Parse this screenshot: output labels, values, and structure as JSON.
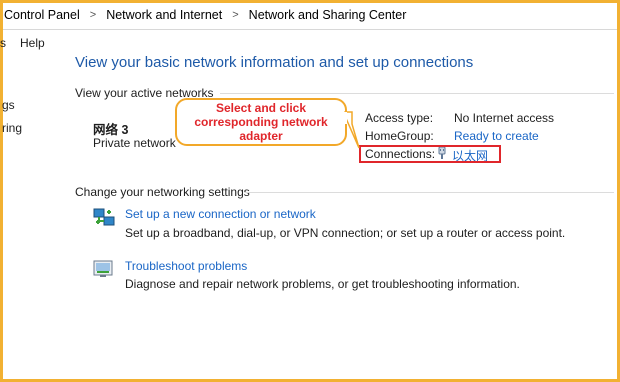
{
  "breadcrumb": {
    "items": [
      "Control Panel",
      "Network and Internet",
      "Network and Sharing Center"
    ],
    "separator": ">"
  },
  "menu": {
    "partial_item": "s",
    "help": "Help"
  },
  "sidebar": {
    "item1_fragment": "gs",
    "item2_fragment": "ring"
  },
  "main": {
    "title": "View your basic network information and set up connections",
    "active_networks_label": "View your active networks",
    "network": {
      "name": "网络 3",
      "type": "Private network",
      "access_type_label": "Access type:",
      "access_type_value": "No Internet access",
      "homegroup_label": "HomeGroup:",
      "homegroup_value": "Ready to create",
      "connections_label": "Connections:",
      "connections_value": "以太网"
    },
    "change_settings_label": "Change your networking settings",
    "tasks": [
      {
        "link": "Set up a new connection or network",
        "description": "Set up a broadband, dial-up, or VPN connection; or set up a router or access point.",
        "icon": "network-setup-icon"
      },
      {
        "link": "Troubleshoot problems",
        "description": "Diagnose and repair network problems, or get troubleshooting information.",
        "icon": "troubleshoot-icon"
      }
    ]
  },
  "annotation": {
    "line1": "Select and click",
    "line2": "corresponding network",
    "line3": "adapter"
  },
  "colors": {
    "link": "#1a66c6",
    "title": "#1e5aa8",
    "callout_border": "#f2a829",
    "callout_text": "#e0262b",
    "highlight_box": "#e0262b",
    "frame": "#f2b132"
  }
}
